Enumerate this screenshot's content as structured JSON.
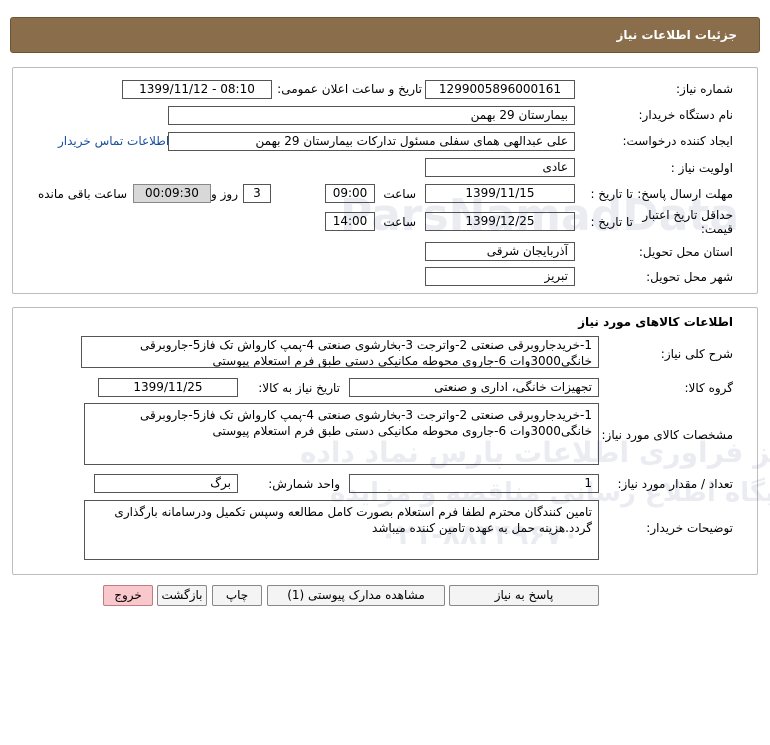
{
  "header": {
    "title": "جزئیات اطلاعات نیاز"
  },
  "need_info": {
    "need_number_label": "شماره نیاز:",
    "need_number": "1299005896000161",
    "announce_label": "تاریخ و ساعت اعلان عمومی:",
    "announce_value": "1399/11/12 - 08:10",
    "buyer_org_label": "نام دستگاه خریدار:",
    "buyer_org": "بیمارستان 29 بهمن",
    "creator_label": "ایجاد کننده درخواست:",
    "creator": "علی عبدالهی همای سفلی مسئول تدارکات بیمارستان 29 بهمن",
    "contact_link": "اطلاعات تماس خریدار",
    "priority_label": "اولویت نیاز :",
    "priority": "عادی",
    "deadline_label": "مهلت ارسال پاسخ:",
    "to_date_label": "تا تاریخ :",
    "deadline_date": "1399/11/15",
    "time_label": "ساعت",
    "deadline_time": "09:00",
    "days_value": "3",
    "days_label": "روز و",
    "remaining_time": "00:09:30",
    "remaining_label": "ساعت باقی مانده",
    "validity_label": "حداقل تاریخ اعتبار قیمت:",
    "validity_to_label": "تا تاریخ :",
    "validity_date": "1399/12/25",
    "validity_time_label": "ساعت",
    "validity_time": "14:00",
    "province_label": "استان محل تحویل:",
    "province": "آذربایجان شرقی",
    "city_label": "شهر محل تحویل:",
    "city": "تبریز"
  },
  "goods": {
    "title": "اطلاعات کالاهای مورد نیاز",
    "description_label": "شرح کلی نیاز:",
    "description": "1-خریدجاروبرقی صنعتی 2-واترجت 3-بخارشوی صنعتی 4-پمپ کارواش تک فاز5-جاروبرقی خانگی3000وات 6-جاروی محوطه مکانیکی دستی طبق فرم استعلام پیوستی",
    "group_label": "گروه کالا:",
    "group": "تجهیزات خانگی، اداری و صنعتی",
    "need_date_label": "تاریخ نیاز به کالا:",
    "need_date": "1399/11/25",
    "specs_label": "مشخصات کالای مورد نیاز:",
    "specs": "1-خریدجاروبرقی صنعتی 2-واترجت 3-بخارشوی صنعتی 4-پمپ کارواش تک فاز5-جاروبرقی خانگی3000وات 6-جاروی محوطه مکانیکی دستی طبق فرم استعلام پیوستی",
    "quantity_label": "تعداد / مقدار مورد نیاز:",
    "quantity": "1",
    "unit_label": "واحد شمارش:",
    "unit": "برگ",
    "buyer_notes_label": "توضیحات خریدار:",
    "buyer_notes": "تامین کنندگان محترم لطفا فرم استعلام بصورت کامل مطالعه وسپس تکمیل ودرسامانه بارگذاری گردد.هزینه حمل به عهده تامین کننده میباشد"
  },
  "actions": {
    "reply": "پاسخ به نیاز",
    "view_docs": "مشاهده مدارک پیوستی (1)",
    "print": "چاپ",
    "back": "بازگشت",
    "exit": "خروج"
  },
  "watermark": {
    "line1": "پایگاه اطلاع رسانی مناقصه و مزایده",
    "line2": "مرکز فراوری اطلاعات پارس نماد داده",
    "phone": "۰۲۱-۸۸۳۴۹۶۷۰",
    "brand": "ParsNamadData"
  }
}
